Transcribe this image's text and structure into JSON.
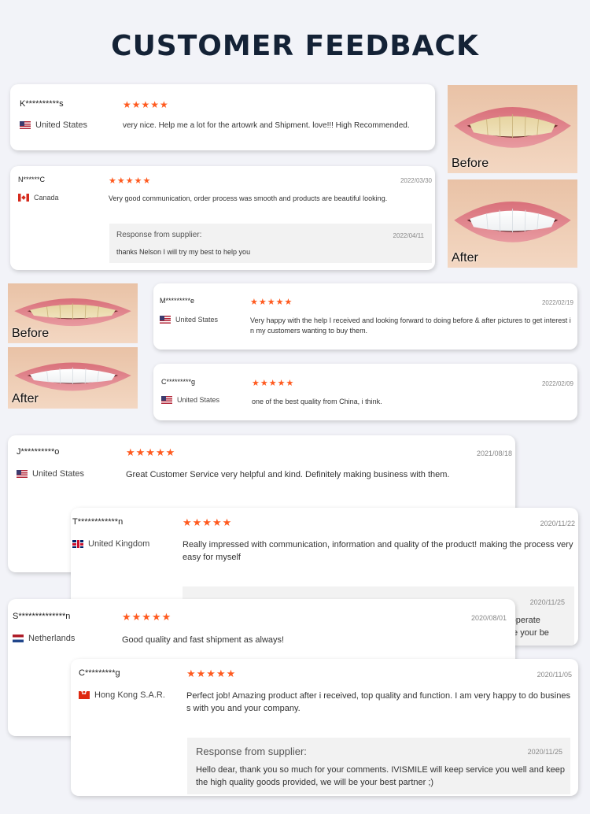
{
  "page": {
    "title": "CUSTOMER FEEDBACK"
  },
  "reviews": [
    {
      "name": "K**********s",
      "country": "United States",
      "flag": "us",
      "stars": "★★★★★",
      "date": "",
      "text": "very nice. Help me a lot for the artowrk and Shipment. love!!! High Recommended."
    },
    {
      "name": "N******C",
      "country": "Canada",
      "flag": "ca",
      "stars": "★★★★★",
      "date": "2022/03/30",
      "text": "Very good communication, order process was smooth and products are beautiful looking.",
      "response": {
        "title": "Response from supplier:",
        "date": "2022/04/11",
        "text": "thanks Nelson I will try my best to help you"
      }
    },
    {
      "name": "M*********e",
      "country": "United States",
      "flag": "us",
      "stars": "★★★★★",
      "date": "2022/02/19",
      "text": "Very happy with the help I received and looking forward to doing before & after pictures to get interest in my customers wanting to buy them."
    },
    {
      "name": "C*********g",
      "country": "United States",
      "flag": "us",
      "stars": "★★★★★",
      "date": "2022/02/09",
      "text": "one of the best quality from China, i think."
    },
    {
      "name": "J**********o",
      "country": "United States",
      "flag": "us",
      "stars": "★★★★★",
      "date": "2021/08/18",
      "text": "Great Customer Service very helpful and kind. Definitely making business with them."
    },
    {
      "name": "T************n",
      "country": "United Kingdom",
      "flag": "uk",
      "stars": "★★★★★",
      "date": "2020/11/22",
      "text": "Really impressed with communication, information and quality of the product! making the process very easy for myself",
      "response": {
        "title": "",
        "date": "2020/11/25",
        "text": "cooperate\nll be your be"
      }
    },
    {
      "name": "S**************n",
      "country": "Netherlands",
      "flag": "nl",
      "stars": "★★★★★",
      "date": "2020/08/01",
      "text": "Good quality and fast shipment as always!"
    },
    {
      "name": "C*********g",
      "country": "Hong Kong S.A.R.",
      "flag": "hk",
      "stars": "★★★★★",
      "date": "2020/11/05",
      "text": "Perfect job! Amazing product after i received, top quality and function. I am very happy to do business with you and your company.",
      "response": {
        "title": "Response from supplier:",
        "date": "2020/11/25",
        "text": "Hello dear, thank you so much for your comments. IVISMILE will keep service you well and keep the high quality goods provided, we will be your best partner ;)"
      }
    }
  ],
  "photos": {
    "before_label": "Before",
    "after_label": "After"
  }
}
